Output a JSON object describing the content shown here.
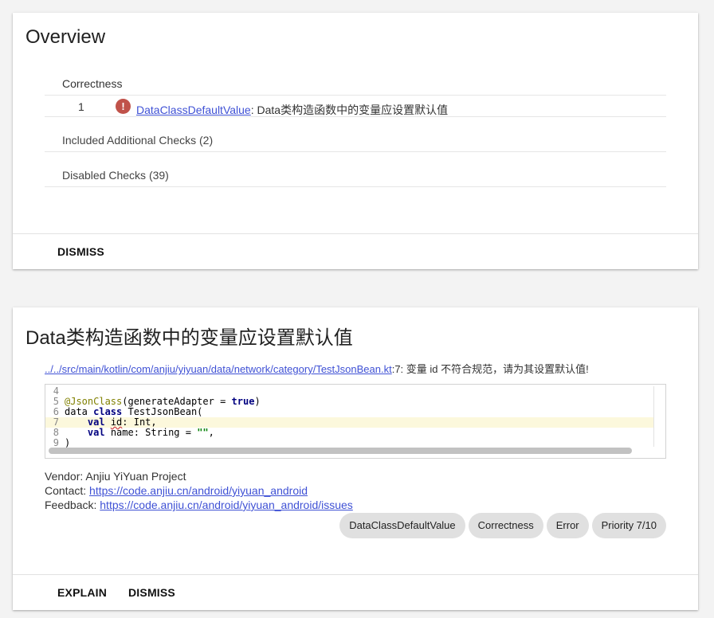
{
  "overview": {
    "title": "Overview",
    "category": "Correctness",
    "issues": [
      {
        "count": "1",
        "id": "DataClassDefaultValue",
        "message": ": Data类构造函数中的变量应设置默认值"
      }
    ],
    "included_checks": "Included Additional Checks (2)",
    "disabled_checks": "Disabled Checks (39)",
    "dismiss_label": "DISMISS"
  },
  "issue": {
    "title": "Data类构造函数中的变量应设置默认值",
    "location_link": "../../src/main/kotlin/com/anjiu/yiyuan/data/network/category/TestJsonBean.kt",
    "location_message": ":7: 变量 id 不符合规范，请为其设置默认值!",
    "code": {
      "highlight_line": "7",
      "lines": [
        {
          "num": "4",
          "text": ""
        },
        {
          "num": "5",
          "annotation": "@JsonClass",
          "text": "(generateAdapter = ",
          "keyword": "true",
          "tail": ")"
        },
        {
          "num": "6",
          "pre": "data ",
          "keyword": "class",
          "text": " TestJsonBean("
        },
        {
          "num": "7",
          "indent": "    ",
          "keyword": "val",
          "warn": "id",
          "text": ": Int,"
        },
        {
          "num": "8",
          "indent": "    ",
          "keyword": "val",
          "text": " name: String = ",
          "string": "\"\"",
          "tail": ","
        },
        {
          "num": "9",
          "text": ")"
        }
      ]
    },
    "vendor_label": "Vendor: ",
    "vendor": "Anjiu YiYuan Project",
    "contact_label": "Contact: ",
    "contact": "https://code.anjiu.cn/android/yiyuan_android",
    "feedback_label": "Feedback: ",
    "feedback": "https://code.anjiu.cn/android/yiyuan_android/issues",
    "chips": [
      "DataClassDefaultValue",
      "Correctness",
      "Error",
      "Priority 7/10"
    ],
    "explain_label": "EXPLAIN",
    "dismiss_label": "DISMISS"
  },
  "colors": {
    "link": "#3f51d5",
    "error_icon": "#c0524a",
    "chip": "#e0e0e0",
    "highlight": "#fcf8dc"
  },
  "icons": {
    "error": "error-icon"
  }
}
